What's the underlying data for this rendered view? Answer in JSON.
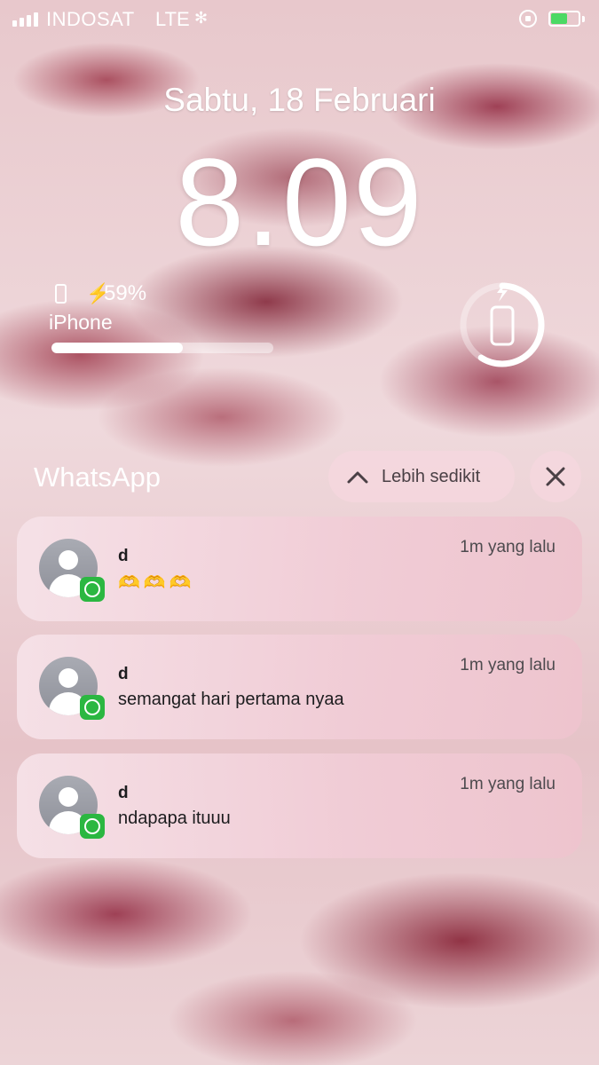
{
  "status_bar": {
    "carrier": "INDOSAT",
    "network": "LTE",
    "signal_bars": 4,
    "battery_level_fraction": 0.59,
    "charging": true
  },
  "lock_screen": {
    "date": "Sabtu, 18 Februari",
    "time": "8.09"
  },
  "battery_widget": {
    "percent_label": "59%",
    "device_name": "iPhone",
    "level_fraction": 0.59
  },
  "notification_group": {
    "app_name": "WhatsApp",
    "show_less_label": "Lebih sedikit",
    "notifications": [
      {
        "sender": "d",
        "message": "🫶🫶🫶",
        "time": "1m yang lalu"
      },
      {
        "sender": "d",
        "message": "semangat hari pertama nyaa",
        "time": "1m yang lalu"
      },
      {
        "sender": "d",
        "message": "ndapapa ituuu",
        "time": "1m yang lalu"
      }
    ]
  },
  "colors": {
    "whatsapp_green": "#2bb741",
    "battery_green": "#4cd964",
    "notification_text": "#1c1c1e"
  },
  "icons": [
    "signal-icon",
    "loading-icon",
    "lock-rotation-icon",
    "battery-icon",
    "phone-icon",
    "bolt-icon",
    "chevron-up-icon",
    "close-icon",
    "avatar",
    "whatsapp-icon"
  ]
}
